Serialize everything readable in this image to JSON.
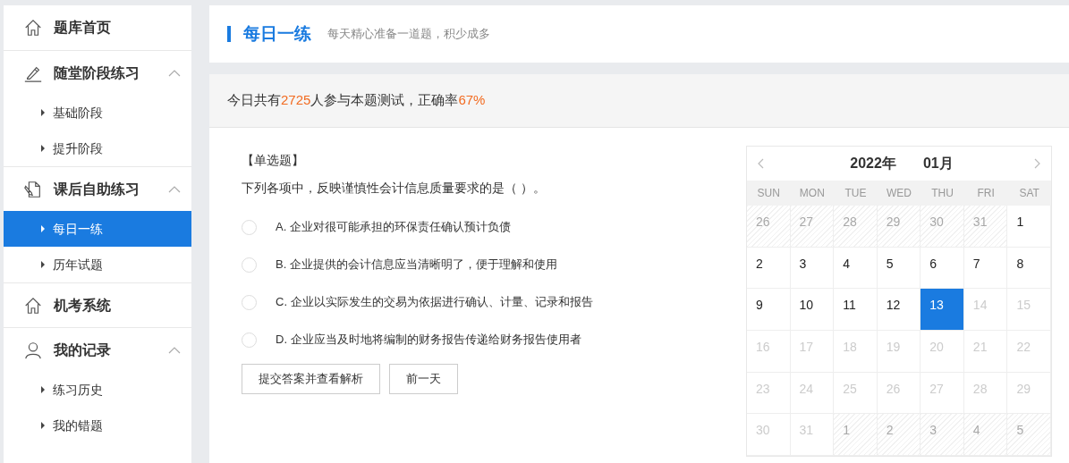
{
  "sidebar": {
    "groups": [
      {
        "label": "题库首页"
      },
      {
        "label": "随堂阶段练习",
        "expanded": true,
        "items": [
          {
            "label": "基础阶段",
            "selected": false
          },
          {
            "label": "提升阶段",
            "selected": false
          }
        ]
      },
      {
        "label": "课后自助练习",
        "expanded": true,
        "items": [
          {
            "label": "每日一练",
            "selected": true
          },
          {
            "label": "历年试题",
            "selected": false
          }
        ]
      },
      {
        "label": "机考系统"
      },
      {
        "label": "我的记录",
        "expanded": true,
        "items": [
          {
            "label": "练习历史",
            "selected": false
          },
          {
            "label": "我的错题",
            "selected": false
          }
        ]
      }
    ]
  },
  "header": {
    "title": "每日一练",
    "subtitle": "每天精心准备一道题，积少成多"
  },
  "stats": {
    "prefix": "今日共有",
    "count": "2725",
    "middle": "人参与本题测试，正确率 ",
    "rate": "67%"
  },
  "question": {
    "type": "【单选题】",
    "text": "下列各项中，反映谨慎性会计信息质量要求的是（   ）。",
    "options": [
      {
        "letter": "A.",
        "text": "企业对很可能承担的环保责任确认预计负债",
        "selected": false
      },
      {
        "letter": "B.",
        "text": "企业提供的会计信息应当清晰明了，便于理解和使用",
        "selected": false
      },
      {
        "letter": "C.",
        "text": "企业以实际发生的交易为依据进行确认、计量、记录和报告",
        "selected": false
      },
      {
        "letter": "D.",
        "text": "企业应当及时地将编制的财务报告传递给财务报告使用者",
        "selected": false
      }
    ],
    "buttons": [
      "提交答案并查看解析",
      "前一天"
    ]
  },
  "calendar": {
    "year": "2022年",
    "month": "01月",
    "weekdays": [
      "SUN",
      "MON",
      "TUE",
      "WED",
      "THU",
      "FRI",
      "SAT"
    ],
    "days": [
      {
        "label": "26",
        "kind": "outside",
        "selected": false
      },
      {
        "label": "27",
        "kind": "outside",
        "selected": false
      },
      {
        "label": "28",
        "kind": "outside",
        "selected": false
      },
      {
        "label": "29",
        "kind": "outside",
        "selected": false
      },
      {
        "label": "30",
        "kind": "outside",
        "selected": false
      },
      {
        "label": "31",
        "kind": "outside",
        "selected": false
      },
      {
        "label": "1",
        "kind": "available",
        "selected": false
      },
      {
        "label": "2",
        "kind": "available",
        "selected": false
      },
      {
        "label": "3",
        "kind": "available",
        "selected": false
      },
      {
        "label": "4",
        "kind": "available",
        "selected": false
      },
      {
        "label": "5",
        "kind": "available",
        "selected": false
      },
      {
        "label": "6",
        "kind": "available",
        "selected": false
      },
      {
        "label": "7",
        "kind": "available",
        "selected": false
      },
      {
        "label": "8",
        "kind": "available",
        "selected": false
      },
      {
        "label": "9",
        "kind": "available",
        "selected": false
      },
      {
        "label": "10",
        "kind": "available",
        "selected": false
      },
      {
        "label": "11",
        "kind": "available",
        "selected": false
      },
      {
        "label": "12",
        "kind": "available",
        "selected": false
      },
      {
        "label": "13",
        "kind": "available",
        "selected": true
      },
      {
        "label": "14",
        "kind": "future",
        "selected": false
      },
      {
        "label": "15",
        "kind": "future",
        "selected": false
      },
      {
        "label": "16",
        "kind": "future",
        "selected": false
      },
      {
        "label": "17",
        "kind": "future",
        "selected": false
      },
      {
        "label": "18",
        "kind": "future",
        "selected": false
      },
      {
        "label": "19",
        "kind": "future",
        "selected": false
      },
      {
        "label": "20",
        "kind": "future",
        "selected": false
      },
      {
        "label": "21",
        "kind": "future",
        "selected": false
      },
      {
        "label": "22",
        "kind": "future",
        "selected": false
      },
      {
        "label": "23",
        "kind": "future",
        "selected": false
      },
      {
        "label": "24",
        "kind": "future",
        "selected": false
      },
      {
        "label": "25",
        "kind": "future",
        "selected": false
      },
      {
        "label": "26",
        "kind": "future",
        "selected": false
      },
      {
        "label": "27",
        "kind": "future",
        "selected": false
      },
      {
        "label": "28",
        "kind": "future",
        "selected": false
      },
      {
        "label": "29",
        "kind": "future",
        "selected": false
      },
      {
        "label": "30",
        "kind": "future",
        "selected": false
      },
      {
        "label": "31",
        "kind": "future",
        "selected": false
      },
      {
        "label": "1",
        "kind": "outside",
        "selected": false
      },
      {
        "label": "2",
        "kind": "outside",
        "selected": false
      },
      {
        "label": "3",
        "kind": "outside",
        "selected": false
      },
      {
        "label": "4",
        "kind": "outside",
        "selected": false
      },
      {
        "label": "5",
        "kind": "outside",
        "selected": false
      }
    ]
  }
}
